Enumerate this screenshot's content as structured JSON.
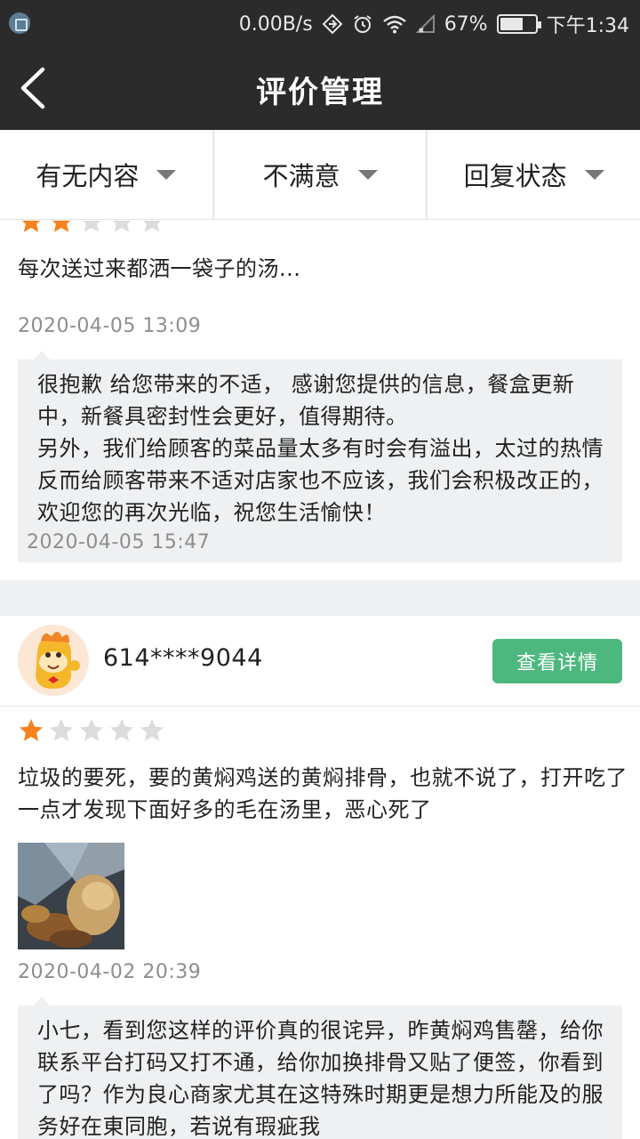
{
  "status_bar": {
    "speed": "0.00B/s",
    "battery": "67%",
    "battery_level": 0.67,
    "time": "下午1:34",
    "icons": [
      "app-icon",
      "data-saver-icon",
      "alarm-icon",
      "wifi-icon",
      "signal-icon",
      "battery-icon"
    ]
  },
  "header": {
    "title": "评价管理"
  },
  "filters": [
    {
      "label": "有无内容"
    },
    {
      "label": "不满意"
    },
    {
      "label": "回复状态"
    }
  ],
  "reviews": [
    {
      "rating": 2,
      "text": "每次送过来都洒一袋子的汤...",
      "date": "2020-04-05  13:09",
      "reply": {
        "text": "很抱歉 给您带来的不适， 感谢您提供的信息，餐盒更新中，新餐具密封性会更好，值得期待。\n另外，我们给顾客的菜品量太多有时会有溢出，太过的热情反而给顾客带来不适对店家也不应该，我们会积极改正的，欢迎您的再次光临，祝您生活愉快！",
        "date": "2020-04-05  15:47"
      }
    },
    {
      "user": "614****9044",
      "detail_button": "查看详情",
      "rating": 1,
      "text": "垃圾的要死，要的黄焖鸡送的黄焖排骨，也就不说了，打开吃了一点才发现下面好多的毛在汤里，恶心死了",
      "date": "2020-04-02  20:39",
      "reply": {
        "text": "小七，看到您这样的评价真的很诧异，昨黄焖鸡售罄，给你联系平台打码又打不通，给你加换排骨又贴了便签，你看到了吗？作为良心商家尤其在这特殊时期更是想力所能及的服务好在東同胞，若说有瑕疵我"
      }
    }
  ],
  "colors": {
    "header_bg": "#2b2b2b",
    "star_on": "#f5821f",
    "star_off": "#dcdcdc",
    "button_green": "#4cb87d",
    "reply_bg": "#eef0f2"
  }
}
